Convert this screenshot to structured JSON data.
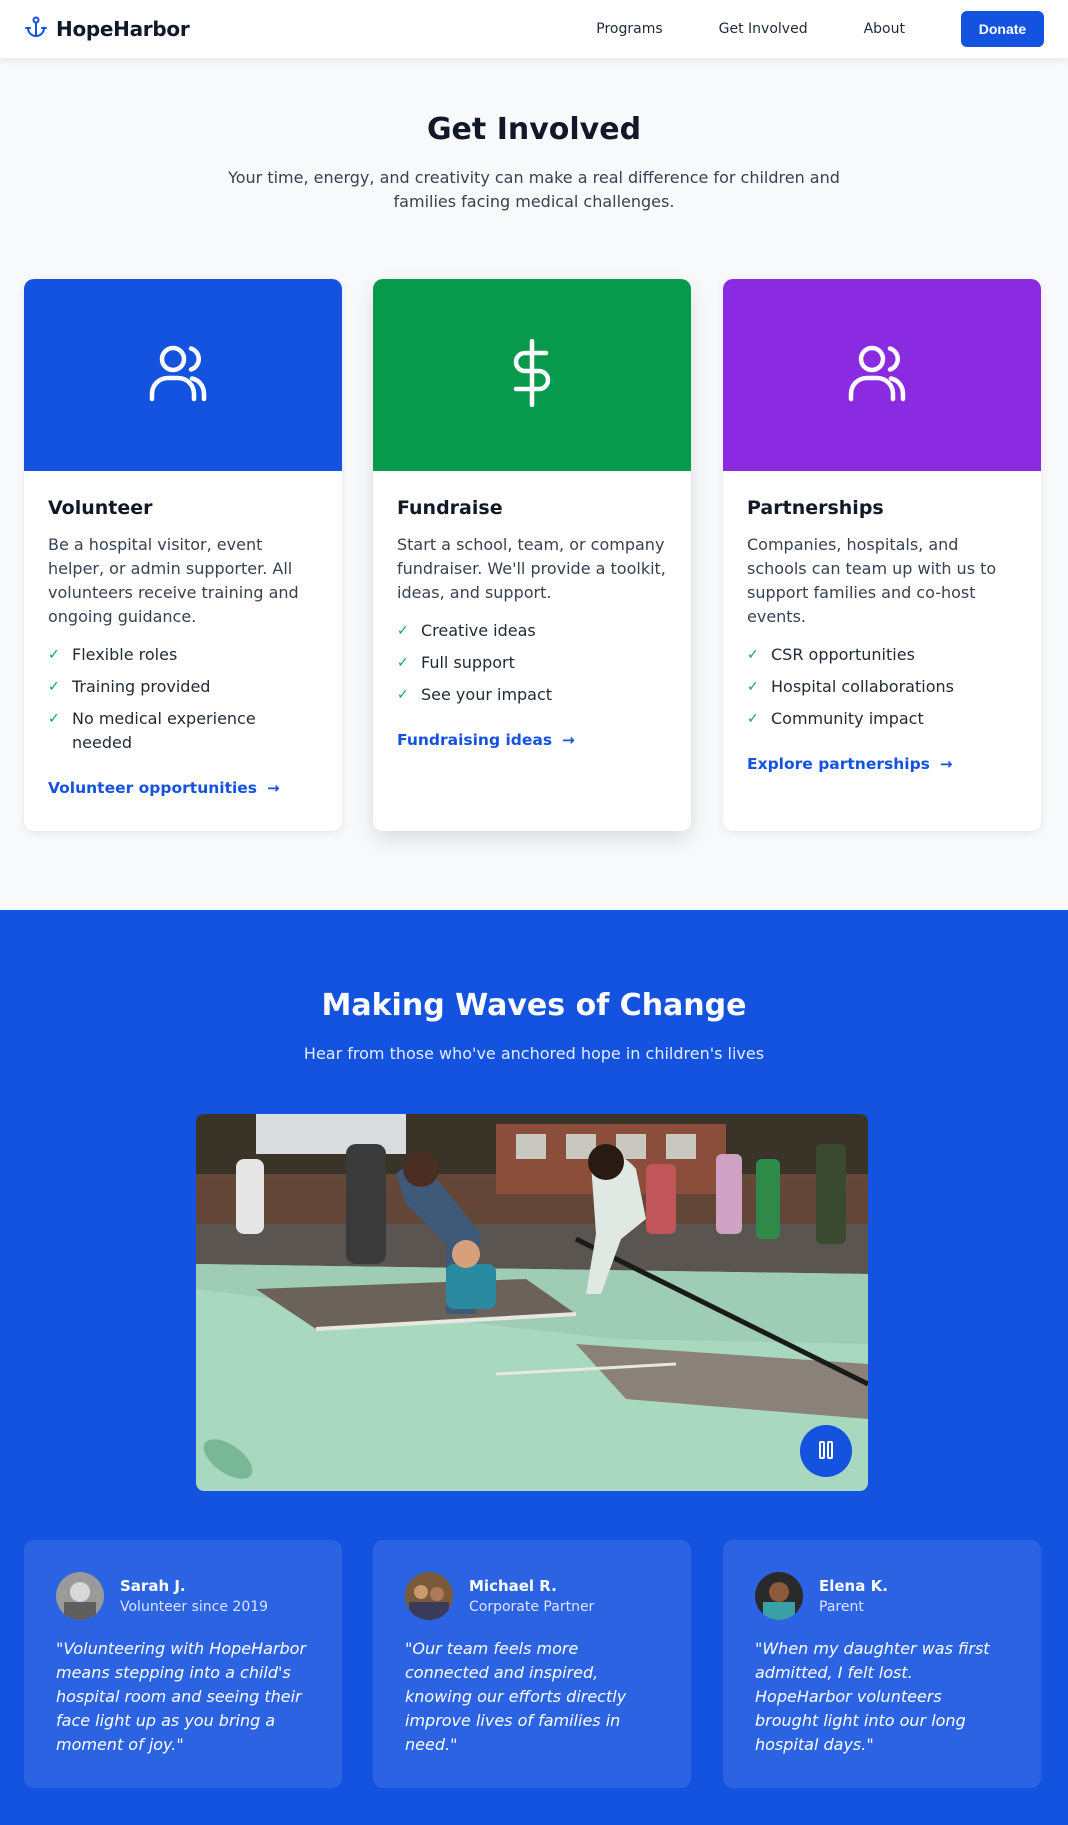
{
  "nav": {
    "brand": "HopeHarbor",
    "links": [
      "Programs",
      "Get Involved",
      "About"
    ],
    "donate": "Donate"
  },
  "get_involved": {
    "title": "Get Involved",
    "subtitle": "Your time, energy, and creativity can make a real difference for children and families facing medical challenges.",
    "cards": [
      {
        "color": "#1452e0",
        "icon": "users-icon",
        "title": "Volunteer",
        "description": "Be a hospital visitor, event helper, or admin supporter. All volunteers receive training and ongoing guidance.",
        "features": [
          "Flexible roles",
          "Training provided",
          "No medical experience needed"
        ],
        "link": "Volunteer opportunities"
      },
      {
        "color": "#079a4c",
        "icon": "dollar-icon",
        "title": "Fundraise",
        "description": "Start a school, team, or company fundraiser. We'll provide a toolkit, ideas, and support.",
        "features": [
          "Creative ideas",
          "Full support",
          "See your impact"
        ],
        "link": "Fundraising ideas"
      },
      {
        "color": "#8a2be2",
        "icon": "users-icon",
        "title": "Partnerships",
        "description": "Companies, hospitals, and schools can team up with us to support families and co-host events.",
        "features": [
          "CSR opportunities",
          "Hospital collaborations",
          "Community impact"
        ],
        "link": "Explore partnerships"
      }
    ]
  },
  "waves": {
    "title": "Making Waves of Change",
    "subtitle": "Hear from those who've anchored hope in children's lives",
    "testimonials": [
      {
        "name": "Sarah J.",
        "role": "Volunteer since 2019",
        "quote": "\"Volunteering with HopeHarbor means stepping into a child's hospital room and seeing their face light up as you bring a moment of joy.\""
      },
      {
        "name": "Michael R.",
        "role": "Corporate Partner",
        "quote": "\"Our team feels more connected and inspired, knowing our efforts directly improve lives of families in need.\""
      },
      {
        "name": "Elena K.",
        "role": "Parent",
        "quote": "\"When my daughter was first admitted, I felt lost. HopeHarbor volunteers brought light into our long hospital days.\""
      }
    ]
  }
}
